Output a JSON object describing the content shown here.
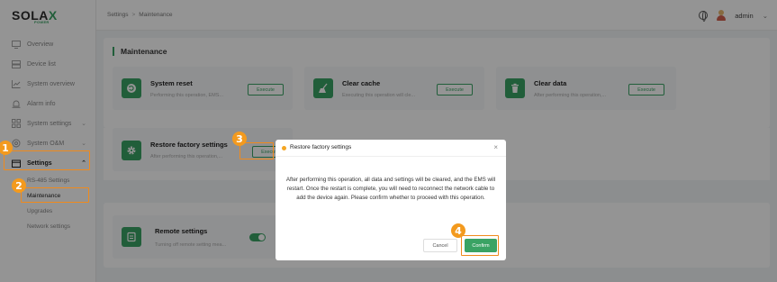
{
  "brand": {
    "name_left": "SOLA",
    "name_x": "X",
    "sub": "POWER"
  },
  "sidebar": {
    "items": [
      {
        "label": "Overview",
        "icon": "monitor-icon"
      },
      {
        "label": "Device list",
        "icon": "list-icon"
      },
      {
        "label": "System overview",
        "icon": "chart-icon"
      },
      {
        "label": "Alarm info",
        "icon": "alarm-icon"
      },
      {
        "label": "System settings",
        "icon": "grid-icon"
      },
      {
        "label": "System O&M",
        "icon": "om-icon"
      },
      {
        "label": "Settings",
        "icon": "settings-icon"
      }
    ],
    "sub_items": [
      {
        "label": "RS-485 Settings"
      },
      {
        "label": "Maintenance"
      },
      {
        "label": "Upgrades"
      },
      {
        "label": "Network settings"
      }
    ]
  },
  "header": {
    "breadcrumb_parent": "Settings",
    "breadcrumb_sep": ">",
    "breadcrumb_current": "Maintenance",
    "user": "admin"
  },
  "main": {
    "section_title": "Maintenance",
    "cards": [
      {
        "title": "System reset",
        "desc": "Performing this operation, EMS...",
        "button": "Execute"
      },
      {
        "title": "Clear cache",
        "desc": "Executing this operation will cle...",
        "button": "Execute"
      },
      {
        "title": "Clear data",
        "desc": "After performing this operation,...",
        "button": "Execute"
      },
      {
        "title": "Restore factory settings",
        "desc": "After performing this operation,...",
        "button": "Execute"
      },
      {
        "title": "Remote settings",
        "desc": "Turning off remote setting mea..."
      }
    ]
  },
  "modal": {
    "title": "Restore factory settings",
    "close": "×",
    "body": "After performing this operation, all data and settings will be cleared, and the EMS will restart. Once the restart is complete, you will need to reconnect the network cable to add the device again. Please confirm whether to proceed with this operation.",
    "cancel": "Cancel",
    "confirm": "Confirm"
  },
  "steps": [
    "1",
    "2",
    "3",
    "4"
  ],
  "colors": {
    "accent": "#3aa364",
    "annotation": "#f39a1e"
  }
}
